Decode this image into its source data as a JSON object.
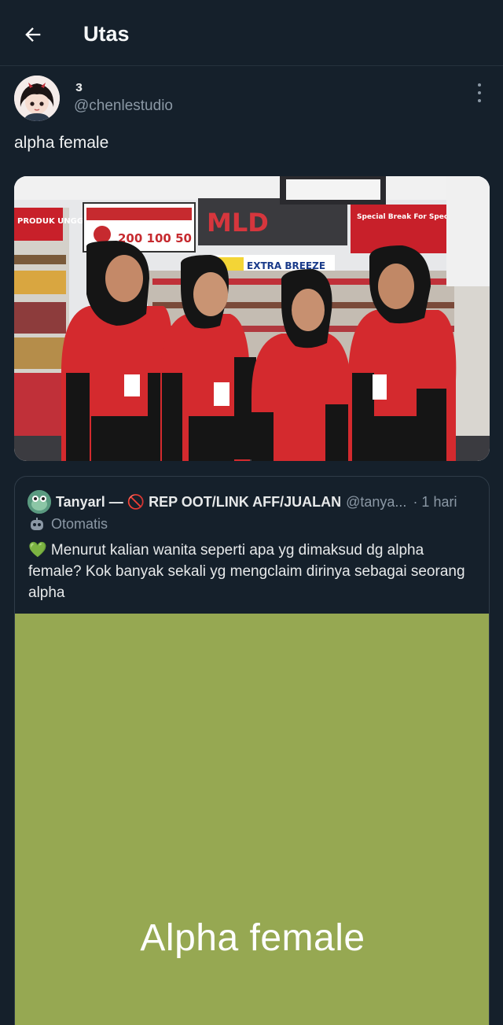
{
  "header": {
    "title": "Utas",
    "back_icon": "arrow-left-icon"
  },
  "tweet": {
    "display_name": "ɜ",
    "handle": "@chenlestudio",
    "text": "alpha female",
    "more_icon": "more-vertical-icon"
  },
  "quote": {
    "name": "Tanyarl — 🚫 REP OOT/LINK AFF/JUALAN",
    "handle": "@tanya...",
    "time": "· 1 hari",
    "automated_label": "Otomatis",
    "text": "💚 Menurut kalian wanita seperti apa yg dimaksud dg alpha female? Kok banyak sekali yg mengclaim dirinya sebagai seorang alpha",
    "media_caption": "Alpha female",
    "media_color": "#96a852"
  },
  "colors": {
    "background": "#15202b",
    "secondary_text": "#8b98a5",
    "border": "#2f3c48"
  },
  "photo_signs": {
    "sign_left": "PRODUK UNGGULAN",
    "sign_promo": "200 100 50",
    "sign_extra": "EXTRA BREEZE",
    "sign_special": "Special Break For Special One"
  }
}
